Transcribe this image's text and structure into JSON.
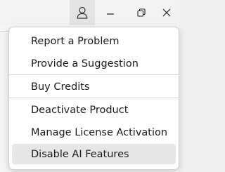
{
  "titlebar": {
    "buttons": [
      {
        "icon": "user-icon"
      },
      {
        "icon": "minimize-icon"
      },
      {
        "icon": "restore-icon"
      },
      {
        "icon": "close-icon"
      }
    ]
  },
  "menu": {
    "items": [
      {
        "label": "Report a Problem"
      },
      {
        "label": "Provide a Suggestion"
      },
      {
        "label": "Buy Credits"
      },
      {
        "label": "Deactivate Product"
      },
      {
        "label": "Manage License Activation"
      },
      {
        "label": "Disable AI Features"
      }
    ],
    "hovered_item": "Disable AI Features"
  },
  "colors": {
    "menu_background": "#ffffff",
    "hover_background": "#e6e6e6",
    "text": "#1a1a1a"
  }
}
